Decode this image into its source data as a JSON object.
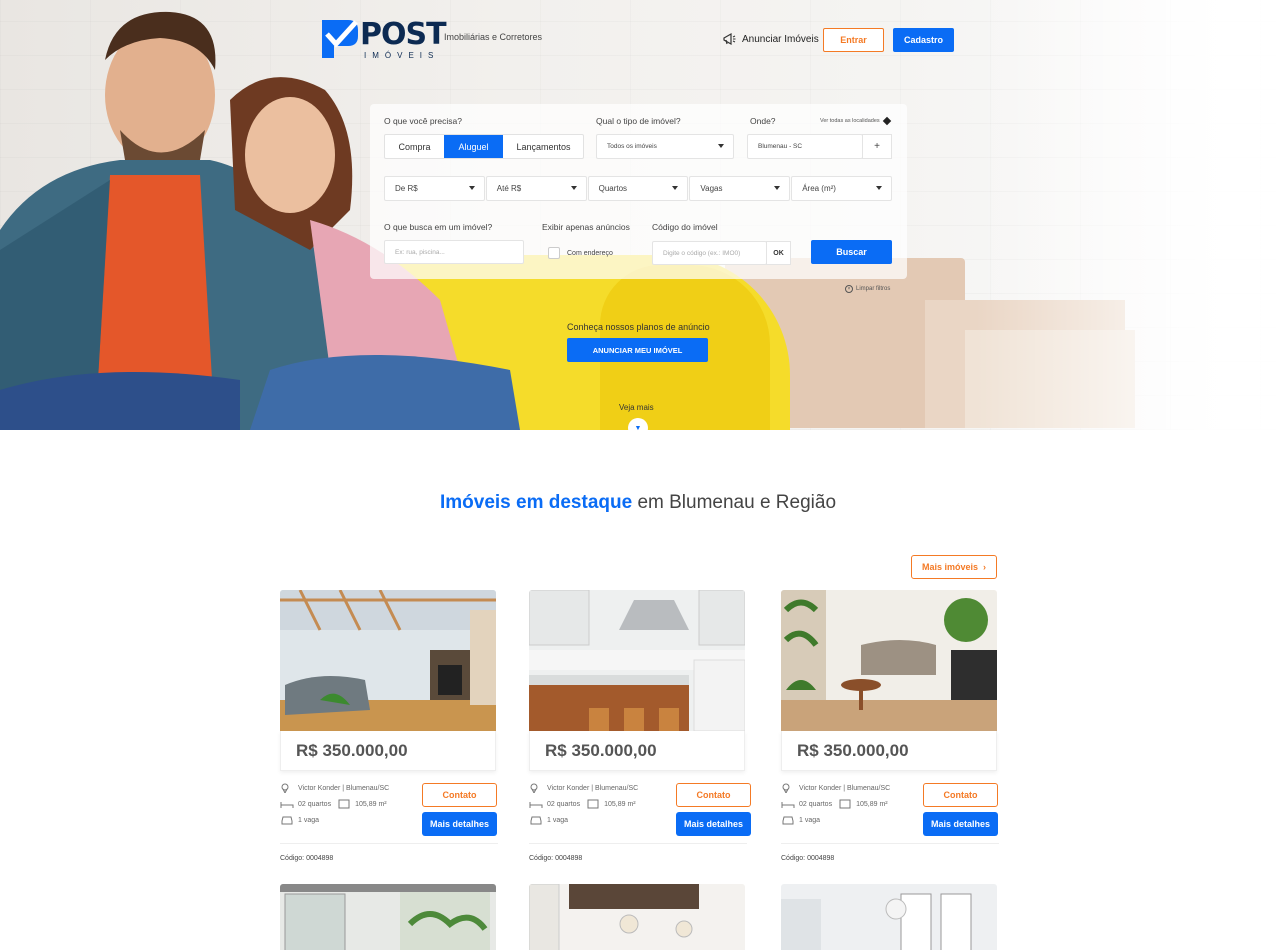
{
  "header": {
    "logo_title": "POST",
    "logo_subtitle": "IMÓVEIS",
    "tagline": "Imobiliárias e Corretores",
    "announce_label": "Anunciar Imóveis",
    "login_label": "Entrar",
    "signup_label": "Cadastro"
  },
  "search": {
    "need_label": "O que você precisa?",
    "tabs": [
      "Compra",
      "Aluguel",
      "Lançamentos"
    ],
    "active_tab": "Aluguel",
    "type_label": "Qual o tipo de imóvel?",
    "type_value": "Todos os imóveis",
    "where_label": "Onde?",
    "see_all_label": "Ver todas as localidades",
    "where_value": "Blumenau - SC",
    "add_label": "+",
    "filters": [
      "De R$",
      "Até R$",
      "Quartos",
      "Vagas",
      "Área (m²)"
    ],
    "keywords_label": "O que busca em um imóvel?",
    "keywords_placeholder": "Ex: rua, piscina...",
    "only_ads_label": "Exibir apenas anúncios",
    "with_address_label": "Com endereço",
    "code_label": "Código do imóvel",
    "code_placeholder": "Digite o código (ex.: IMO0)",
    "ok_label": "OK",
    "search_button": "Buscar",
    "clear_filters": "Limpar filtros"
  },
  "promo": {
    "plans_text": "Conheça nossos planos de anúncio",
    "plans_button": "ANUNCIAR MEU IMÓVEL",
    "see_more": "Veja mais"
  },
  "featured": {
    "title_bold": "Imóveis em destaque",
    "title_rest": " em Blumenau e Região",
    "more_button": "Mais imóveis",
    "cards": [
      {
        "price": "R$ 350.000,00",
        "location": "Victor Konder | Blumenau/SC",
        "rooms": "02 quartos",
        "area": "105,89 m²",
        "parking": "1 vaga",
        "code": "Código: 0004898",
        "contact": "Contato",
        "details": "Mais detalhes"
      },
      {
        "price": "R$ 350.000,00",
        "location": "Victor Konder | Blumenau/SC",
        "rooms": "02 quartos",
        "area": "105,89 m²",
        "parking": "1 vaga",
        "code": "Código: 0004898",
        "contact": "Contato",
        "details": "Mais detalhes"
      },
      {
        "price": "R$ 350.000,00",
        "location": "Victor Konder | Blumenau/SC",
        "rooms": "02 quartos",
        "area": "105,89 m²",
        "parking": "1 vaga",
        "code": "Código: 0004898",
        "contact": "Contato",
        "details": "Mais detalhes"
      }
    ]
  },
  "colors": {
    "brand_blue": "#0a6cf5",
    "accent_orange": "#f47a25",
    "logo_navy": "#0c2a52"
  }
}
